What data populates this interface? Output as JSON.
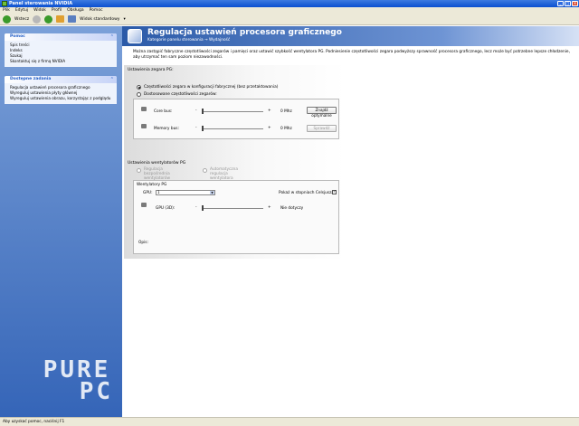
{
  "window": {
    "title": "Panel sterowania NVIDIA"
  },
  "menu": [
    "Plik",
    "Edytuj",
    "Widok",
    "Profil",
    "Obsługa",
    "Pomoc"
  ],
  "toolbar": {
    "back_label": "Wstecz",
    "view_label": "Widok standardowy"
  },
  "sidebar": {
    "help_panel": {
      "title": "Pomoc",
      "items": [
        "Spis treści",
        "Indeks",
        "Szukaj",
        "Skontaktuj się z firmą NVIDIA"
      ]
    },
    "tasks_panel": {
      "title": "Dostępne zadania",
      "items": [
        "Regulacja ustawień procesora graficznego",
        "Wyreguluj ustawienia płyty głównej",
        "Wyreguluj ustawienia obrazu, korzystając z podglądu"
      ]
    }
  },
  "header": {
    "title": "Regulacja ustawień procesora graficznego",
    "category_label": "Kategorie panelu sterowania",
    "breadcrumb": "Wydajność"
  },
  "description": "Można zastąpić fabryczne częstotliwości zegarów i pamięci oraz ustawić szybkość wentylatora PG. Podniesienie częstotliwości zegara podwyższy sprawność procesora graficznego, lecz może być potrzebne lepsze chłodzenie, aby utrzymać ten sam poziom niezawodności.",
  "clock": {
    "section_title": "Ustawienia zegara PG:",
    "option_factory": "Częstotliwości zegara w konfiguracji fabrycznej (bez przetaktowania)",
    "option_custom": "Dostosowane częstotliwości zegarów:",
    "core": {
      "label": "Core bus:",
      "minus": "-",
      "plus": "+",
      "value": "0 Mhz",
      "level": 0.0
    },
    "memory": {
      "label": "Memory bus:",
      "minus": "-",
      "plus": "+",
      "value": "0 Mhz",
      "level": 0.0
    },
    "find_optimal_label": "Znajdź optymalne",
    "apply_label": "Sprawdź"
  },
  "fans": {
    "section_title": "Ustawienia wentylatorów PG",
    "option_disabled": "Regulacja bezpośrednia wentylatorów",
    "option_auto": "Automatyczna regulacja wentylatora",
    "group_title": "Wentylatory PG",
    "gpu_label": "GPU:",
    "gpu_value": "1",
    "celsius_label": "Pokaż w stopniach Celsjusza",
    "celsius_checked": true,
    "fan_label": "GPU (3D):",
    "fan_minus": "-",
    "fan_plus": "+",
    "fan_value": "Nie dotyczy",
    "fan_level": 0.0
  },
  "opis_label": "Opis:",
  "watermark": {
    "line1": "PURE",
    "line2": "PC"
  },
  "status": "Aby uzyskać pomoc, naciśnij F1"
}
